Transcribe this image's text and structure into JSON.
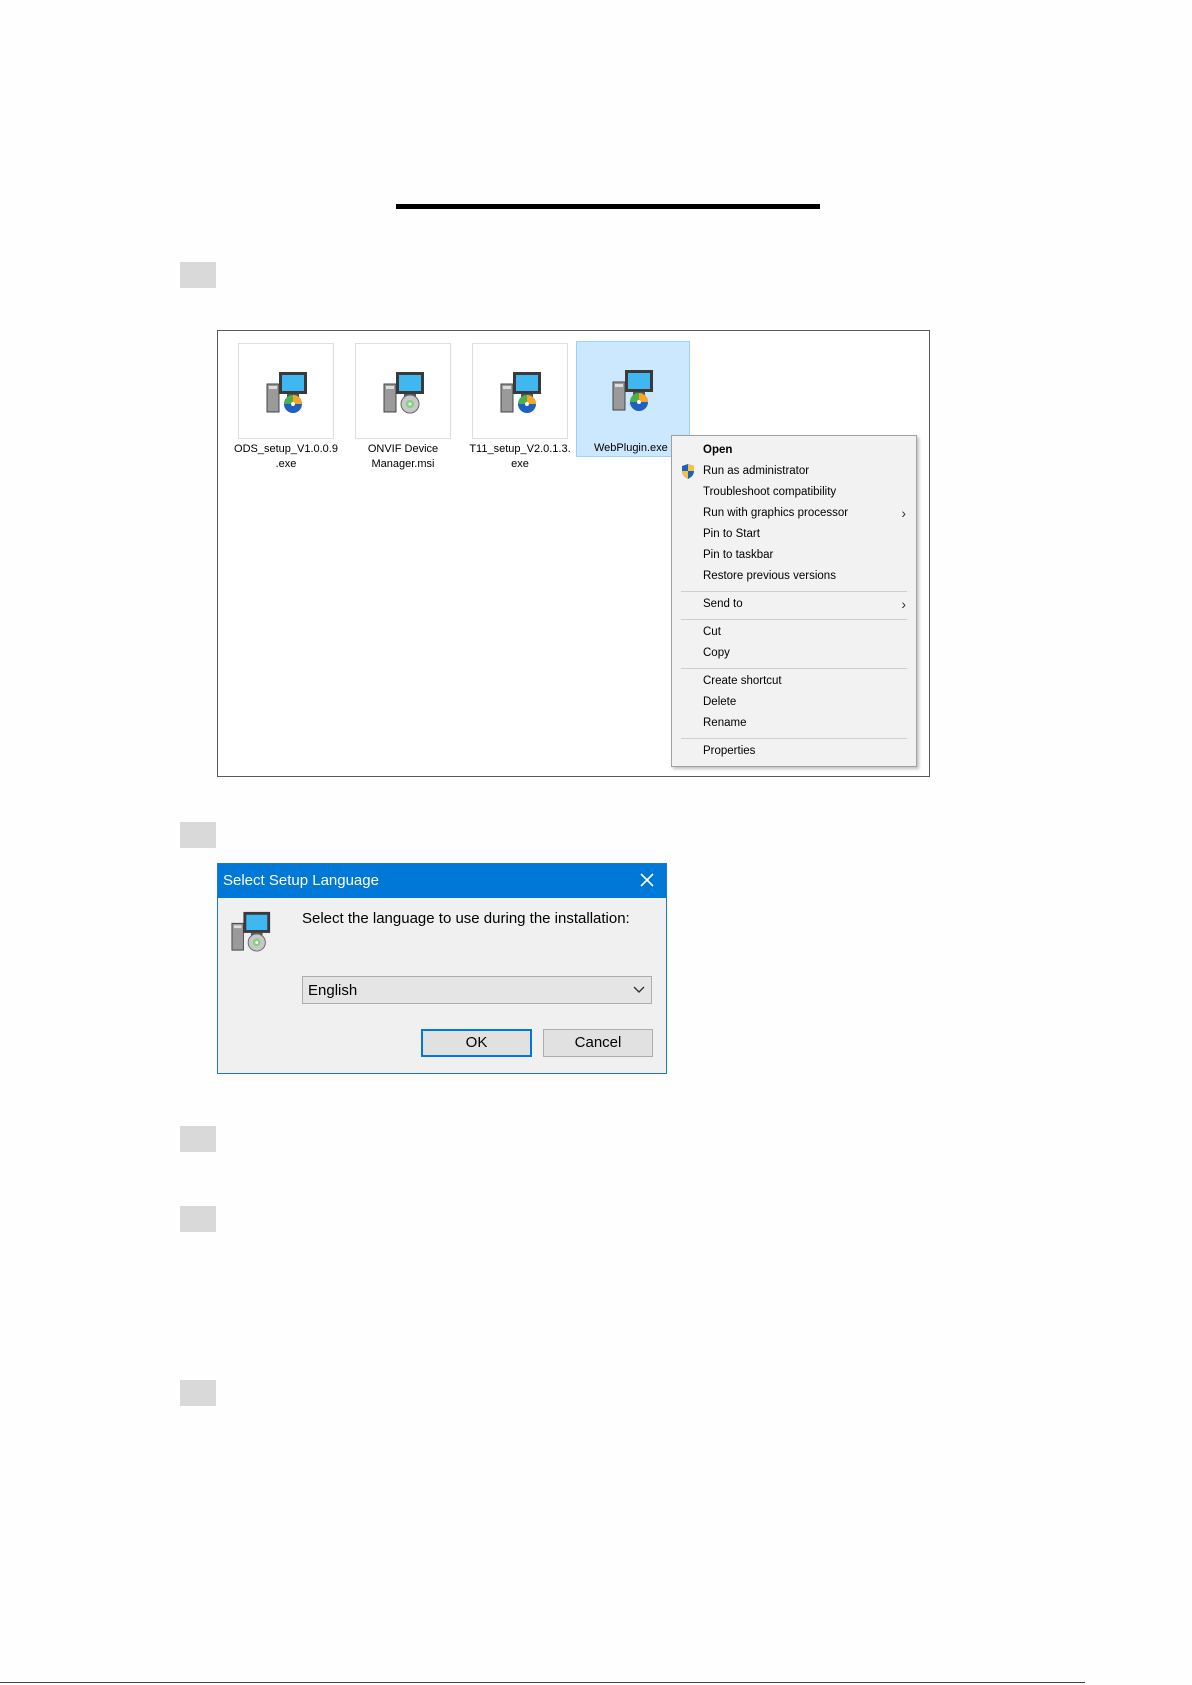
{
  "files": [
    {
      "name": "ODS_setup_V1.0.0.9\n.exe",
      "selected": false
    },
    {
      "name": "ONVIF Device\nManager.msi",
      "selected": false
    },
    {
      "name": "T11_setup_V2.0.1.3.\nexe",
      "selected": false
    },
    {
      "name": "WebPlugin.exe",
      "selected": true
    }
  ],
  "context_menu": {
    "open": "Open",
    "run_as_admin": "Run as administrator",
    "troubleshoot": "Troubleshoot compatibility",
    "run_graphics": "Run with graphics processor",
    "pin_start": "Pin to Start",
    "pin_taskbar": "Pin to taskbar",
    "restore": "Restore previous versions",
    "send_to": "Send to",
    "cut": "Cut",
    "copy": "Copy",
    "create_shortcut": "Create shortcut",
    "delete": "Delete",
    "rename": "Rename",
    "properties": "Properties"
  },
  "dialog": {
    "title": "Select Setup Language",
    "message": "Select the language to use during the installation:",
    "language": "English",
    "ok": "OK",
    "cancel": "Cancel"
  },
  "colors": {
    "titlebar": "#0078d7",
    "selection": "#cce8ff",
    "step_box": "#d9d9d9"
  }
}
